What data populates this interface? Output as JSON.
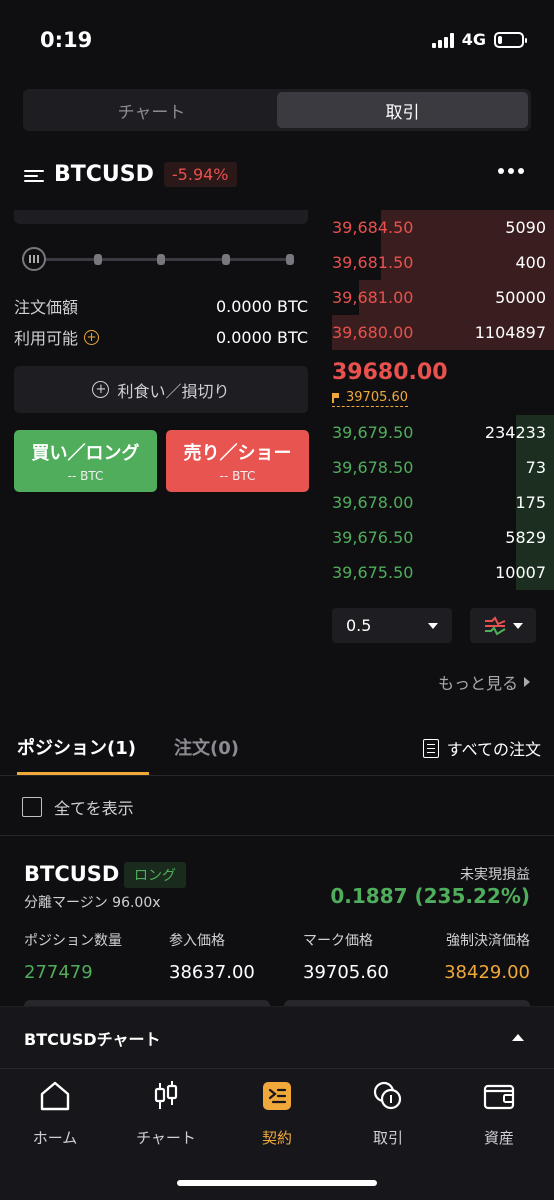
{
  "status_bar": {
    "time": "0:19",
    "network": "4G"
  },
  "top_tabs": [
    {
      "label": "チャート",
      "active": false
    },
    {
      "label": "取引",
      "active": true
    }
  ],
  "symbol": {
    "name": "BTCUSD",
    "change": "-5.94%"
  },
  "form": {
    "order_value_label": "注文価額",
    "order_value": "0.0000 BTC",
    "available_label": "利用可能",
    "available_value": "0.0000 BTC",
    "tpsl_label": "利食い／損切り",
    "buy_label": "買い／ロング",
    "buy_sub": "-- BTC",
    "sell_label": "売り／ショー",
    "sell_sub": "-- BTC"
  },
  "order_book": {
    "asks": [
      {
        "price": "39,684.50",
        "qty": "5090",
        "depth": 0.78
      },
      {
        "price": "39,681.50",
        "qty": "400",
        "depth": 0.78
      },
      {
        "price": "39,681.00",
        "qty": "50000",
        "depth": 0.88
      },
      {
        "price": "39,680.00",
        "qty": "1104897",
        "depth": 1.0
      }
    ],
    "last_price": "39680.00",
    "mark_price": "39705.60",
    "bids": [
      {
        "price": "39,679.50",
        "qty": "234233",
        "depth": 0.17
      },
      {
        "price": "39,678.50",
        "qty": "73",
        "depth": 0.17
      },
      {
        "price": "39,678.00",
        "qty": "175",
        "depth": 0.17
      },
      {
        "price": "39,676.50",
        "qty": "5829",
        "depth": 0.17
      },
      {
        "price": "39,675.50",
        "qty": "10007",
        "depth": 0.17
      }
    ],
    "depth_step": "0.5",
    "see_more": "もっと見る"
  },
  "positions_tabs": {
    "positions": "ポジション(1)",
    "orders": "注文(0)",
    "all_orders": "すべての注文"
  },
  "show_all": "全てを表示",
  "position": {
    "symbol": "BTCUSD",
    "side": "ロング",
    "margin": "分離マージン 96.00x",
    "pnl_label": "未実現損益",
    "pnl_value": "0.1887 (235.22%)",
    "qty_label": "ポジション数量",
    "qty": "277479",
    "entry_label": "参入価格",
    "entry": "38637.00",
    "mark_label": "マーク価格",
    "mark": "39705.60",
    "liq_label": "強制決済価格",
    "liq": "38429.00"
  },
  "chart_bar": {
    "title": "BTCUSDチャート"
  },
  "bottom_nav": [
    {
      "label": "ホーム",
      "icon": "home-icon",
      "active": false
    },
    {
      "label": "チャート",
      "icon": "candlestick-icon",
      "active": false
    },
    {
      "label": "契約",
      "icon": "contract-icon",
      "active": true
    },
    {
      "label": "取引",
      "icon": "exchange-icon",
      "active": false
    },
    {
      "label": "資産",
      "icon": "wallet-icon",
      "active": false
    }
  ],
  "colors": {
    "up": "#4fad5b",
    "down": "#e8514d",
    "accent": "#f0a83a"
  }
}
